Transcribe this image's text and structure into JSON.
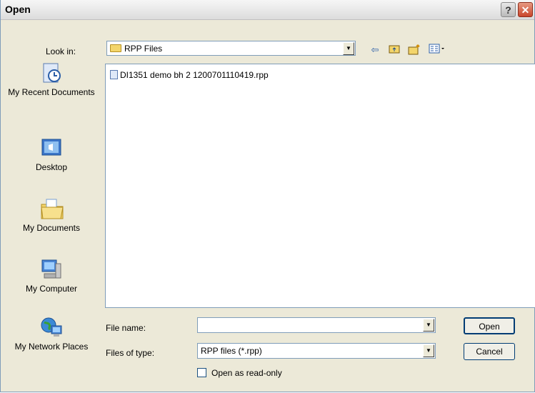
{
  "window": {
    "title": "Open",
    "help_glyph": "?",
    "close_glyph": "✕"
  },
  "lookin": {
    "label": "Look in:",
    "value": "RPP Files"
  },
  "toolbar": {
    "back_icon": "back-arrow-icon",
    "up_icon": "up-folder-icon",
    "new_folder_icon": "new-folder-icon",
    "view_menu_icon": "view-menu-icon"
  },
  "places": [
    {
      "label": "My Recent Documents",
      "icon": "recent-documents-icon"
    },
    {
      "label": "Desktop",
      "icon": "desktop-icon"
    },
    {
      "label": "My Documents",
      "icon": "my-documents-icon"
    },
    {
      "label": "My Computer",
      "icon": "my-computer-icon"
    },
    {
      "label": "My Network Places",
      "icon": "network-places-icon"
    }
  ],
  "files": [
    {
      "name": "DI1351 demo  bh 2  1200701110419.rpp"
    }
  ],
  "filename": {
    "label": "File name:",
    "value": ""
  },
  "filetype": {
    "label": "Files of type:",
    "value": "RPP files (*.rpp)"
  },
  "readonly": {
    "label": "Open as read-only",
    "checked": false
  },
  "buttons": {
    "open": "Open",
    "cancel": "Cancel"
  },
  "colors": {
    "frame": "#ece9d8",
    "border": "#7f9db9",
    "close": "#c9452b"
  }
}
